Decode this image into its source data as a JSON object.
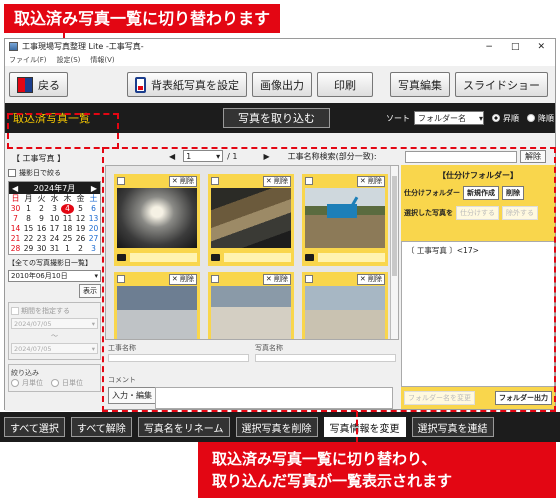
{
  "callouts": {
    "top": "取込済み写真一覧に切り替わります",
    "bottom_line1": "取込済み写真一覧に切り替わり、",
    "bottom_line2": "取り込んだ写真が一覧表示されます"
  },
  "window": {
    "title": "工事現場写真整理 Lite -工事写真-",
    "minimize": "−",
    "maximize": "□",
    "close": "✕"
  },
  "menu": [
    "ファイル(F)",
    "設定(S)",
    "情報(V)"
  ],
  "toolbar": {
    "back": "戻る",
    "wallpaper": "背表紙写真を設定",
    "image_output": "画像出力",
    "print": "印刷",
    "photo_edit": "写真編集",
    "slideshow": "スライドショー"
  },
  "subbar": {
    "title": "取込済写真一覧",
    "import": "写真を取り込む",
    "sort_label": "ソート",
    "sort_value": "フォルダー名",
    "asc": "昇順",
    "desc": "降順"
  },
  "left": {
    "header": "【 工事写真 】",
    "filter_date": "撮影日で絞る",
    "calendar": {
      "title": "2024年7月",
      "weekdays": [
        "日",
        "月",
        "火",
        "水",
        "木",
        "金",
        "土"
      ],
      "days": [
        "30",
        "1",
        "2",
        "3",
        "4",
        "5",
        "6",
        "7",
        "8",
        "9",
        "10",
        "11",
        "12",
        "13",
        "14",
        "15",
        "16",
        "17",
        "18",
        "19",
        "20",
        "21",
        "22",
        "23",
        "24",
        "25",
        "26",
        "27",
        "28",
        "29",
        "30",
        "31",
        "1",
        "2",
        "3"
      ],
      "today": "4"
    },
    "all_dates": "【全ての写真撮影日一覧】",
    "date_value": "2010年06月10日",
    "show": "表示",
    "period_label": "期間を指定する",
    "period_from": "2024/07/05",
    "period_tilde": "〜",
    "period_to": "2024/07/05",
    "narrow": "絞り込み",
    "by_month": "月単位",
    "by_day": "日単位"
  },
  "center": {
    "page_value": "1",
    "page_total": "/ 1",
    "search_label": "工事名称検索(部分一致):",
    "clear": "解除",
    "delete": "✕ 削除",
    "info_label1": "工事名称",
    "info_label2": "写真名称",
    "comment_label": "コメント",
    "comment_btn": "入力・編集"
  },
  "right": {
    "title": "【仕分けフォルダー】",
    "folder_label": "仕分けフォルダー",
    "new": "新規作成",
    "remove": "削除",
    "selected_label": "選択した写真を",
    "sort_into": "仕分けする",
    "exclude": "除外する",
    "tree_item": "〔 工事写真 〕<17>",
    "rename_folder": "フォルダー名を変更",
    "folder_output": "フォルダー出力"
  },
  "bottom": {
    "select_all": "すべて選択",
    "deselect_all": "すべて解除",
    "rename": "写真名をリネーム",
    "delete_sel": "選択写真を削除",
    "change_info": "写真情報を変更",
    "link_sel": "選択写真を連結"
  },
  "colors": {
    "accent_red": "#e30613",
    "card_yellow": "#f9d64c",
    "dark_bar": "#1c1c1c"
  }
}
